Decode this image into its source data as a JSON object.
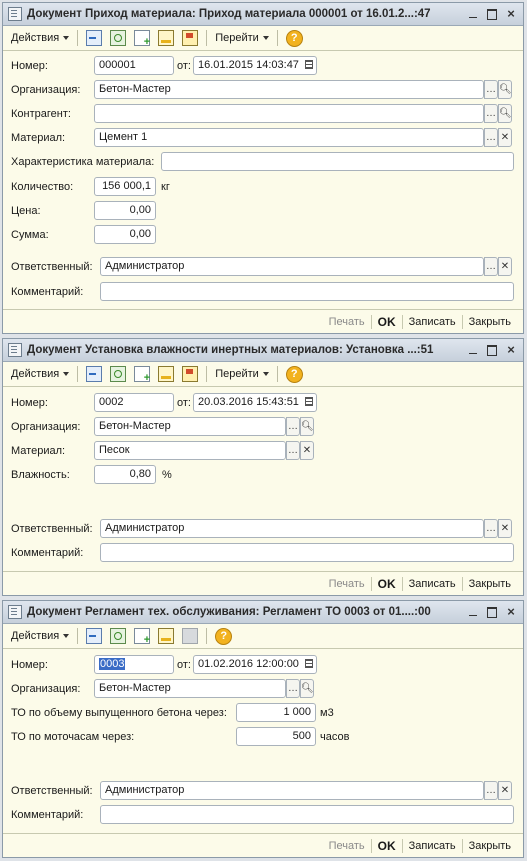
{
  "toolbar": {
    "actions_label": "Действия",
    "goto_label": "Перейти",
    "help_label": "?"
  },
  "footer": {
    "print": "Печать",
    "ok": "OK",
    "save": "Записать",
    "close": "Закрыть"
  },
  "win1": {
    "title": "Документ Приход материала: Приход материала 000001 от 16.01.2...:47",
    "number_label": "Номер:",
    "number": "000001",
    "from_label": "от:",
    "date": "16.01.2015 14:03:47",
    "org_label": "Организация:",
    "org": "Бетон-Мастер",
    "contractor_label": "Контрагент:",
    "contractor": "",
    "material_label": "Материал:",
    "material": "Цемент 1",
    "charact_label": "Характеристика материала:",
    "charact": "",
    "qty_label": "Количество:",
    "qty": "156 000,1",
    "qty_unit": "кг",
    "price_label": "Цена:",
    "price": "0,00",
    "sum_label": "Сумма:",
    "sum": "0,00",
    "resp_label": "Ответственный:",
    "resp": "Администратор",
    "comment_label": "Комментарий:",
    "comment": ""
  },
  "win2": {
    "title": "Документ Установка влажности инертных материалов: Установка ...:51",
    "number_label": "Номер:",
    "number": "0002",
    "from_label": "от:",
    "date": "20.03.2016 15:43:51",
    "org_label": "Организация:",
    "org": "Бетон-Мастер",
    "material_label": "Материал:",
    "material": "Песок",
    "humidity_label": "Влажность:",
    "humidity": "0,80",
    "humidity_unit": "%",
    "resp_label": "Ответственный:",
    "resp": "Администратор",
    "comment_label": "Комментарий:",
    "comment": ""
  },
  "win3": {
    "title": "Документ Регламент тех. обслуживания: Регламент ТО 0003 от 01....:00",
    "number_label": "Номер:",
    "number": "0003",
    "from_label": "от:",
    "date": "01.02.2016 12:00:00",
    "org_label": "Организация:",
    "org": "Бетон-Мастер",
    "volume_label": "ТО по объему выпущенного бетона через:",
    "volume": "1 000",
    "volume_unit": "м3",
    "hours_label": "ТО по моточасам через:",
    "hours": "500",
    "hours_unit": "часов",
    "resp_label": "Ответственный:",
    "resp": "Администратор",
    "comment_label": "Комментарий:",
    "comment": ""
  }
}
